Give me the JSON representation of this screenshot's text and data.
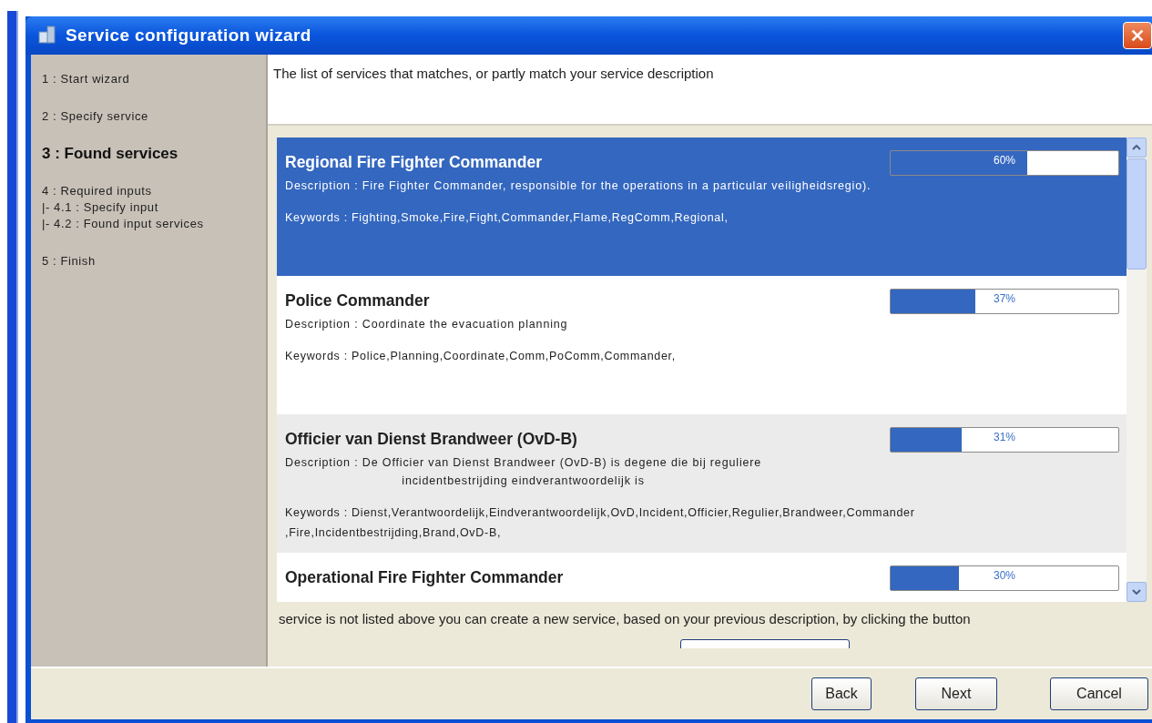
{
  "window": {
    "title": "Service configuration wizard"
  },
  "steps": [
    {
      "label": "1 : Start wizard",
      "selected": false
    },
    {
      "label": "2 : Specify service",
      "selected": false
    },
    {
      "label": "3 : Found services",
      "selected": true
    },
    {
      "label": "4 : Required inputs",
      "selected": false,
      "children": [
        {
          "label": "|- 4.1 : Specify input",
          "selected": false
        },
        {
          "label": "|- 4.2 : Found input services",
          "selected": false
        }
      ]
    },
    {
      "label": "5 : Finish",
      "selected": false
    }
  ],
  "intro": "The list of services that matches, or partly match your service description",
  "services": [
    {
      "name": "Regional Fire Fighter Commander",
      "selected": true,
      "level": 0.6,
      "score": "60%",
      "description": [
        "Description : Fire Fighter Commander, responsible for the operations in a particular veiligheidsregio)."
      ],
      "keywords": [
        "Keywords : Fighting,Smoke,Fire,Fight,Commander,Flame,RegComm,Regional,"
      ]
    },
    {
      "name": "Police Commander",
      "selected": false,
      "level": 0.37,
      "score": "37%",
      "description": [
        "Description : Coordinate the evacuation planning"
      ],
      "keywords": [
        "Keywords : Police,Planning,Coordinate,Comm,PoComm,Commander,"
      ]
    },
    {
      "name": "Officier van Dienst Brandweer (OvD-B)",
      "selected": false,
      "level": 0.31,
      "score": "31%",
      "description": [
        "Description : De Officier van Dienst Brandweer (OvD-B) is degene die bij reguliere",
        "incidentbestrijding eindverantwoordelijk is"
      ],
      "keywords": [
        "Keywords : Dienst,Verantwoordelijk,Eindverantwoordelijk,OvD,Incident,Officier,Regulier,Brandweer,Commander",
        ",Fire,Incidentbestrijding,Brand,OvD-B,"
      ]
    },
    {
      "name": "Operational Fire Fighter Commander",
      "selected": false,
      "level": 0.3,
      "score": "30%"
    }
  ],
  "note": "service is not listed above you can create a new service, based on your previous description, by clicking the button",
  "buttons": [
    "Back",
    "Next",
    "Cancel"
  ]
}
